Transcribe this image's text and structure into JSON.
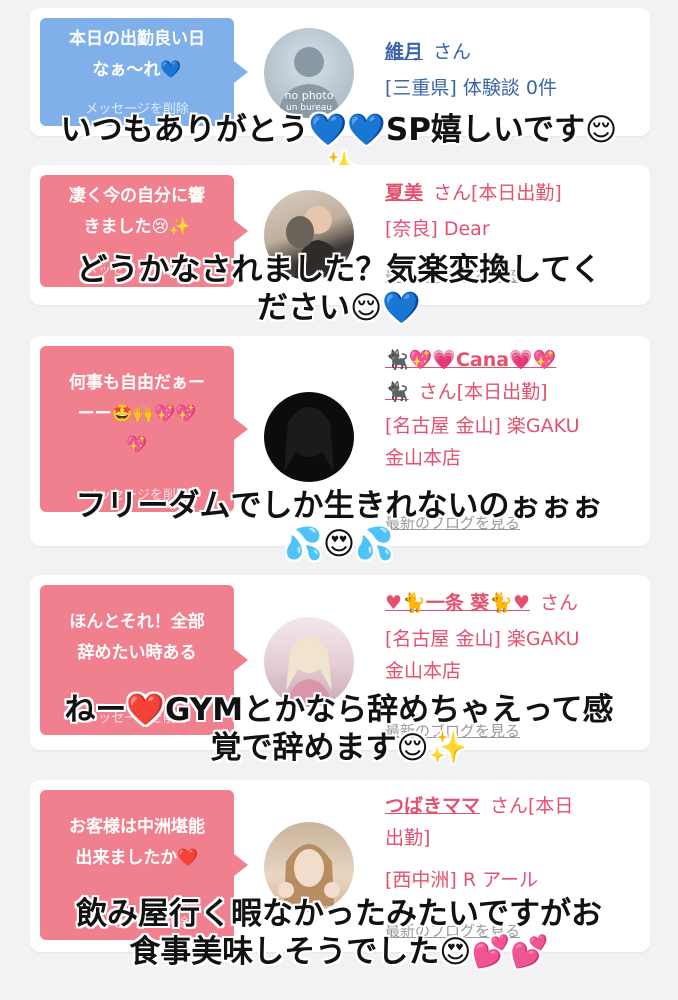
{
  "cards": [
    {
      "theme": "blue",
      "bubble_line1": "本日の出勤良い日",
      "bubble_line2": "なぁ〜れ💙",
      "bubble_delete": "メッセージを削除",
      "avatar_text1": "no photo",
      "avatar_text2": "un bureau",
      "name": "維月",
      "san": "さん",
      "detail1": "[三重県] 体験談 0件",
      "detail2": "",
      "detail3": "",
      "blog_link": "",
      "caption1": "いつもありがとう💙💙SP嬉しいです😌",
      "caption2": "✨"
    },
    {
      "theme": "pink",
      "bubble_line1": "凄く今の自分に響",
      "bubble_line2": "きました😢✨",
      "bubble_delete": "メッセージを削除",
      "name": "夏美",
      "san": "さん[本日出勤]",
      "detail1": "[奈良] Dear",
      "detail2": "",
      "detail3": "",
      "blog_link": "最新のブログを見る",
      "caption1": "どうかなされました？気楽変換してく",
      "caption2": "ださい😌💙"
    },
    {
      "theme": "pink",
      "bubble_line1": "何事も自由だぁー",
      "bubble_line2": "ーー🤩🙌💖💖",
      "bubble_line3": "💖",
      "bubble_delete": "メッセージを削除",
      "name": "🐈‍⬛💖💗Cana💗💖",
      "name2": "🐈‍⬛",
      "san": "さん[本日出勤]",
      "detail1": "[名古屋 金山] 楽GAKU",
      "detail2": "金山本店",
      "blog_link": "最新のブログを見る",
      "caption1": "フリーダムでしか生きれないのぉぉぉ",
      "caption2": "💦😍💦"
    },
    {
      "theme": "pink",
      "bubble_line1": "ほんとそれ！全部",
      "bubble_line2": "辞めたい時ある",
      "bubble_delete": "メッセージを削除",
      "name": "♥🐈一条 葵🐈♥",
      "san": "さん",
      "detail1": "[名古屋 金山] 楽GAKU",
      "detail2": "金山本店",
      "blog_link": "最新のブログを見る",
      "caption1": "ねー❤️GYMとかなら辞めちゃえって感",
      "caption2": "覚で辞めます😌✨"
    },
    {
      "theme": "pink",
      "bubble_line1": "お客様は中洲堪能",
      "bubble_line2": "出来ましたか❤️",
      "bubble_delete": "メッセージを削除",
      "name": "つばきママ",
      "san": "さん[本日",
      "san2": "出勤]",
      "detail1": "[西中洲] R アール",
      "blog_link": "最新のブログを見る",
      "caption1": "飲み屋行く暇なかったみたいですがお",
      "caption2": "食事美味しそうでした😍💕💕"
    }
  ],
  "colors": {
    "bubble_blue": "#7fb0ea",
    "bubble_pink": "#f1808f",
    "name_blue": "#3a63a8",
    "name_pink": "#e4506d"
  }
}
